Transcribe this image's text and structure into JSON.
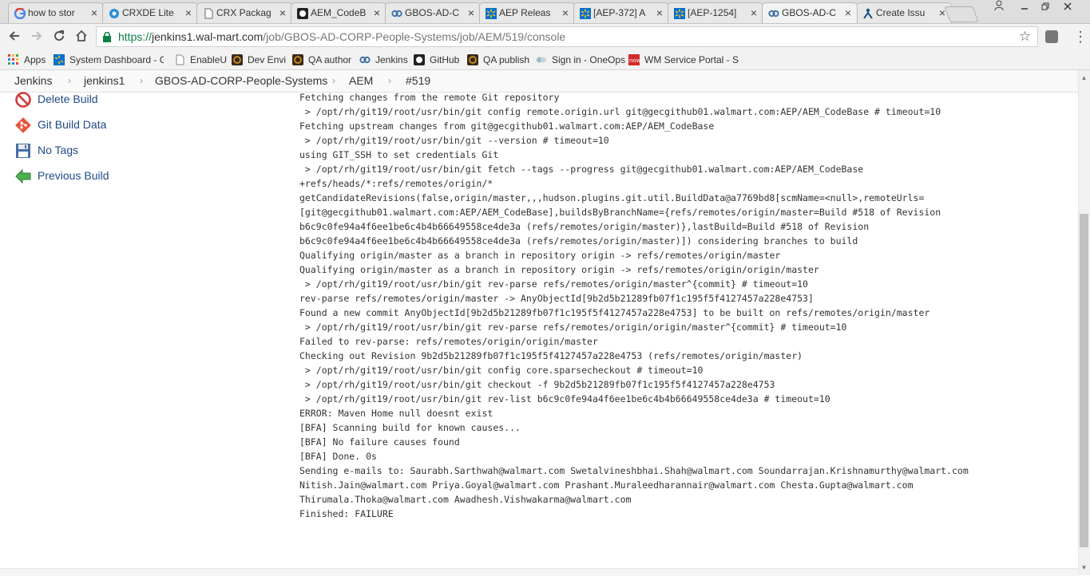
{
  "browser": {
    "tabs": [
      {
        "title": "how to stor",
        "icon": "google-icon",
        "active": false
      },
      {
        "title": "CRXDE Lite",
        "icon": "crxde-icon",
        "active": false
      },
      {
        "title": "CRX Packag",
        "icon": "page-icon",
        "active": false
      },
      {
        "title": "AEM_CodeB",
        "icon": "github-icon",
        "active": false
      },
      {
        "title": "GBOS-AD-C",
        "icon": "jenkins-icon",
        "active": false
      },
      {
        "title": "AEP Releas",
        "icon": "walmart-icon",
        "active": false
      },
      {
        "title": "[AEP-372] A",
        "icon": "walmart-icon",
        "active": false
      },
      {
        "title": "[AEP-1254]",
        "icon": "walmart-icon",
        "active": false
      },
      {
        "title": "GBOS-AD-C",
        "icon": "jenkins-icon",
        "active": true
      },
      {
        "title": "Create Issu",
        "icon": "jira-icon",
        "active": false
      }
    ],
    "tab_close": "×",
    "url": {
      "scheme": "https://",
      "host": "jenkins1.wal-mart.com",
      "path": "/job/GBOS-AD-CORP-People-Systems/job/AEM/519/console"
    },
    "bookmarks": [
      {
        "label": "Apps",
        "icon": "apps-grid-icon"
      },
      {
        "label": "System Dashboard - Glo",
        "icon": "walmart-icon"
      },
      {
        "label": "EnableU",
        "icon": "page-icon"
      },
      {
        "label": "Dev Envi",
        "icon": "aem-icon"
      },
      {
        "label": "QA author",
        "icon": "aem-icon"
      },
      {
        "label": "Jenkins",
        "icon": "jenkins-icon"
      },
      {
        "label": "GitHub",
        "icon": "github-icon"
      },
      {
        "label": "QA publish",
        "icon": "aem-icon"
      },
      {
        "label": "Sign in - OneOps",
        "icon": "oneops-icon"
      },
      {
        "label": "WM Service Portal - Ser",
        "icon": "now-icon"
      }
    ],
    "colors": {
      "secure_green": "#0b8043",
      "jenkins_link": "#204a87"
    }
  },
  "breadcrumb": [
    "Jenkins",
    "jenkins1",
    "GBOS-AD-CORP-People-Systems",
    "AEM",
    "#519"
  ],
  "breadcrumb_separator": "›",
  "side_panel": [
    {
      "label": "Delete Build",
      "icon": "delete-icon"
    },
    {
      "label": "Git Build Data",
      "icon": "git-icon"
    },
    {
      "label": "No Tags",
      "icon": "floppy-disk-icon"
    },
    {
      "label": "Previous Build",
      "icon": "arrow-left-icon"
    }
  ],
  "console": [
    "Fetching changes from the remote Git repository",
    " > /opt/rh/git19/root/usr/bin/git config remote.origin.url git@gecgithub01.walmart.com:AEP/AEM_CodeBase # timeout=10",
    "Fetching upstream changes from git@gecgithub01.walmart.com:AEP/AEM_CodeBase",
    " > /opt/rh/git19/root/usr/bin/git --version # timeout=10",
    "using GIT_SSH to set credentials Git",
    " > /opt/rh/git19/root/usr/bin/git fetch --tags --progress git@gecgithub01.walmart.com:AEP/AEM_CodeBase",
    "+refs/heads/*:refs/remotes/origin/*",
    "getCandidateRevisions(false,origin/master,,,hudson.plugins.git.util.BuildData@a7769bd8[scmName=<null>,remoteUrls=",
    "[git@gecgithub01.walmart.com:AEP/AEM_CodeBase],buildsByBranchName={refs/remotes/origin/master=Build #518 of Revision",
    "b6c9c0fe94a4f6ee1be6c4b4b66649558ce4de3a (refs/remotes/origin/master)},lastBuild=Build #518 of Revision",
    "b6c9c0fe94a4f6ee1be6c4b4b66649558ce4de3a (refs/remotes/origin/master)]) considering branches to build",
    "Qualifying origin/master as a branch in repository origin -> refs/remotes/origin/master",
    "Qualifying origin/master as a branch in repository origin -> refs/remotes/origin/origin/master",
    " > /opt/rh/git19/root/usr/bin/git rev-parse refs/remotes/origin/master^{commit} # timeout=10",
    "rev-parse refs/remotes/origin/master -> AnyObjectId[9b2d5b21289fb07f1c195f5f4127457a228e4753]",
    "Found a new commit AnyObjectId[9b2d5b21289fb07f1c195f5f4127457a228e4753] to be built on refs/remotes/origin/master",
    " > /opt/rh/git19/root/usr/bin/git rev-parse refs/remotes/origin/origin/master^{commit} # timeout=10",
    "Failed to rev-parse: refs/remotes/origin/origin/master",
    "Checking out Revision 9b2d5b21289fb07f1c195f5f4127457a228e4753 (refs/remotes/origin/master)",
    " > /opt/rh/git19/root/usr/bin/git config core.sparsecheckout # timeout=10",
    " > /opt/rh/git19/root/usr/bin/git checkout -f 9b2d5b21289fb07f1c195f5f4127457a228e4753",
    " > /opt/rh/git19/root/usr/bin/git rev-list b6c9c0fe94a4f6ee1be6c4b4b66649558ce4de3a # timeout=10",
    "ERROR: Maven Home null doesnt exist",
    "[BFA] Scanning build for known causes...",
    "[BFA] No failure causes found",
    "[BFA] Done. 0s",
    "Sending e-mails to: Saurabh.Sarthwah@walmart.com Swetalvineshbhai.Shah@walmart.com Soundarrajan.Krishnamurthy@walmart.com",
    "Nitish.Jain@walmart.com Priya.Goyal@walmart.com Prashant.Muraleedharannair@walmart.com Chesta.Gupta@walmart.com",
    "Thirumala.Thoka@walmart.com Awadhesh.Vishwakarma@walmart.com",
    "Finished: FAILURE"
  ]
}
